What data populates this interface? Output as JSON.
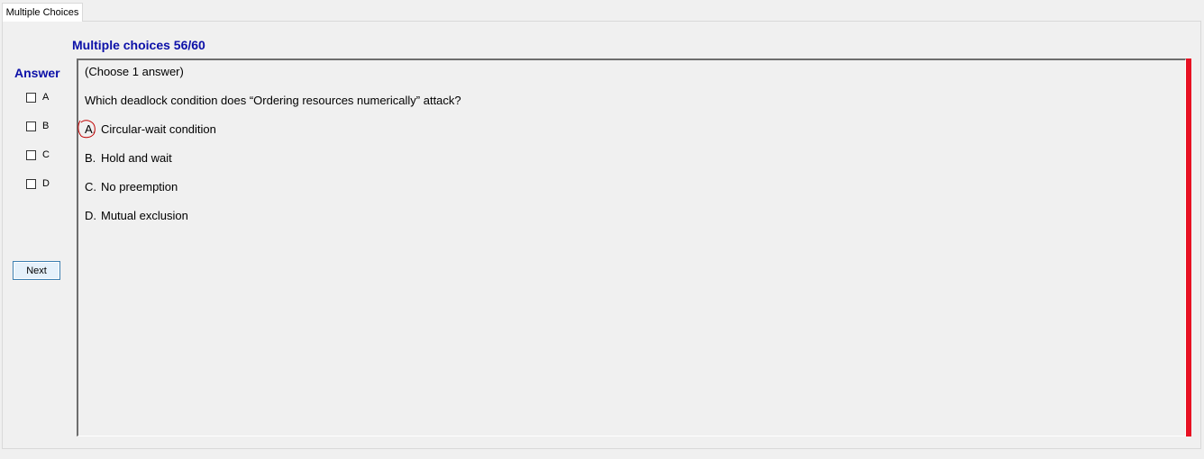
{
  "tab": {
    "label": "Multiple Choices"
  },
  "header": {
    "title": "Multiple choices 56/60"
  },
  "answer_panel": {
    "label": "Answer",
    "options": [
      {
        "label": "A"
      },
      {
        "label": "B"
      },
      {
        "label": "C"
      },
      {
        "label": "D"
      }
    ],
    "next_label": "Next"
  },
  "question": {
    "instruction": "(Choose 1 answer)",
    "text": "Which deadlock condition does “Ordering resources numerically” attack?",
    "options": [
      {
        "letter": "A.",
        "text": "Circular-wait condition"
      },
      {
        "letter": "B.",
        "text": "Hold and wait"
      },
      {
        "letter": "C.",
        "text": "No preemption"
      },
      {
        "letter": "D.",
        "text": "Mutual exclusion"
      }
    ]
  },
  "colors": {
    "title": "#0c10a8",
    "accent_bar": "#e81123",
    "annotation": "#c00000"
  }
}
